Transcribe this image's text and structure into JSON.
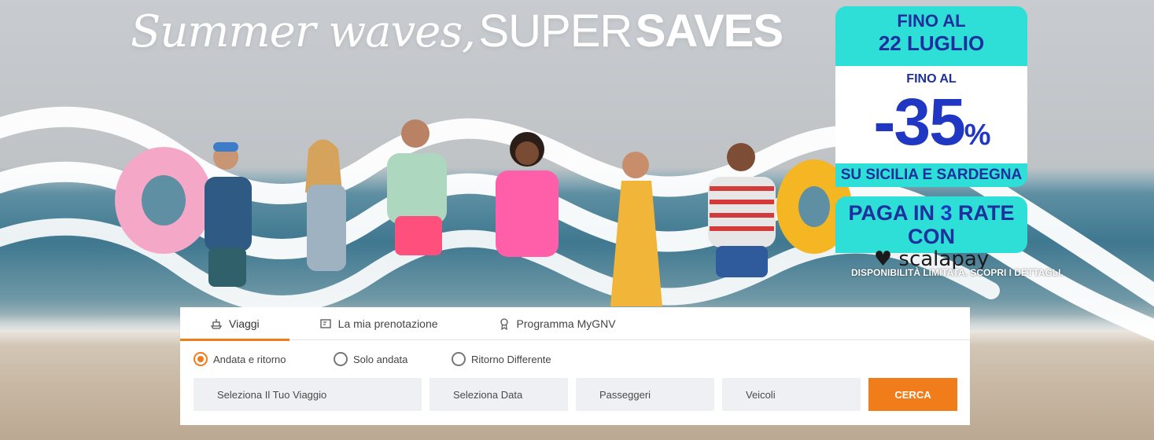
{
  "headline": {
    "script": "Summer waves,",
    "super": "SUPER",
    "saves": "SAVES"
  },
  "promo": {
    "top_line1": "FINO AL",
    "top_line2": "22 LUGLIO",
    "discount_prefix": "FINO AL",
    "discount_value": "-35",
    "discount_unit": "%",
    "destinations": "SU SICILIA E SARDEGNA",
    "pay_line_pre": "PAGA IN",
    "pay_line_num": "3",
    "pay_line_post": "RATE CON",
    "pay_brand": "scalapay",
    "disclaimer": "DISPONIBILITÀ LIMITATA. SCOPRI I DETTAGLI.",
    "colors": {
      "teal": "#2ddfd6",
      "navy": "#1f2f9c"
    }
  },
  "booking": {
    "tabs": [
      {
        "label": "Viaggi",
        "icon": "ship-icon",
        "active": true
      },
      {
        "label": "La mia prenotazione",
        "icon": "ticket-icon",
        "active": false
      },
      {
        "label": "Programma MyGNV",
        "icon": "award-icon",
        "active": false
      }
    ],
    "trip_types": [
      {
        "label": "Andata e ritorno",
        "checked": true
      },
      {
        "label": "Solo andata",
        "checked": false
      },
      {
        "label": "Ritorno Differente",
        "checked": false
      }
    ],
    "fields": {
      "trip": "Seleziona Il Tuo Viaggio",
      "date": "Seleziona Data",
      "passengers": "Passeggeri",
      "vehicles": "Veicoli"
    },
    "search_label": "CERCA",
    "accent_color": "#f07d1a"
  }
}
